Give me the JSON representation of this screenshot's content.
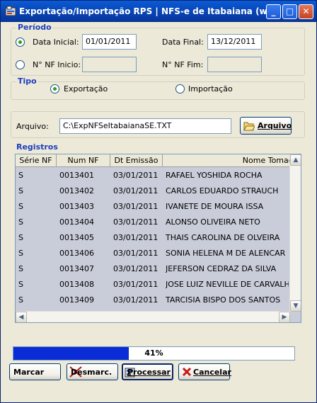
{
  "window": {
    "title": "Exportação/Importação RPS   |   NFS-e de Itabaiana (w...",
    "minimize_glyph": "_",
    "maximize_glyph": "□",
    "close_glyph": "✕"
  },
  "periodo": {
    "group_label": "Período",
    "data_inicial_label": "Data Inicial:",
    "data_inicial_value": "01/01/2011",
    "data_final_label": "Data Final:",
    "data_final_value": "13/12/2011",
    "nf_inicio_label": "N° NF Inicio:",
    "nf_inicio_value": "",
    "nf_fim_label": "N° NF Fim:",
    "nf_fim_value": "",
    "selected": "data"
  },
  "tipo": {
    "group_label": "Tipo",
    "exportacao_label": "Exportação",
    "importacao_label": "Importação",
    "selected": "exportacao"
  },
  "arquivo": {
    "label": "Arquivo:",
    "value": "C:\\ExpNFSeItabaianaSE.TXT",
    "button_label": "Arquivo"
  },
  "registros": {
    "group_label": "Registros",
    "columns": [
      "Série NF",
      "Num NF",
      "Dt Emissão",
      "Nome Tomador"
    ],
    "rows": [
      [
        "S",
        "0013401",
        "03/01/2011",
        "RAFAEL YOSHIDA ROCHA"
      ],
      [
        "S",
        "0013402",
        "03/01/2011",
        "CARLOS EDUARDO STRAUCH"
      ],
      [
        "S",
        "0013403",
        "03/01/2011",
        "IVANETE DE MOURA ISSA"
      ],
      [
        "S",
        "0013404",
        "03/01/2011",
        "ALONSO OLIVEIRA NETO"
      ],
      [
        "S",
        "0013405",
        "03/01/2011",
        "THAIS CAROLINA DE OLVEIRA"
      ],
      [
        "S",
        "0013406",
        "03/01/2011",
        "SONIA HELENA M DE ALENCAR"
      ],
      [
        "S",
        "0013407",
        "03/01/2011",
        "JEFERSON CEDRAZ DA SILVA"
      ],
      [
        "S",
        "0013408",
        "03/01/2011",
        "JOSE LUIZ NEVILLE DE CARVALHO"
      ],
      [
        "S",
        "0013409",
        "03/01/2011",
        "TARCISIA BISPO DOS SANTOS"
      ]
    ]
  },
  "progress": {
    "percent": 41,
    "label": "41%",
    "fill_color": "#0a2cd6"
  },
  "buttons": {
    "marcar": "Marcar",
    "desmarc": "Desmarc.",
    "processar": "Processar",
    "cancelar": "Cancelar"
  },
  "colors": {
    "titlebar": "#0842b0",
    "group_label": "#1c3fbf",
    "grid_background": "#c9ccd9"
  }
}
